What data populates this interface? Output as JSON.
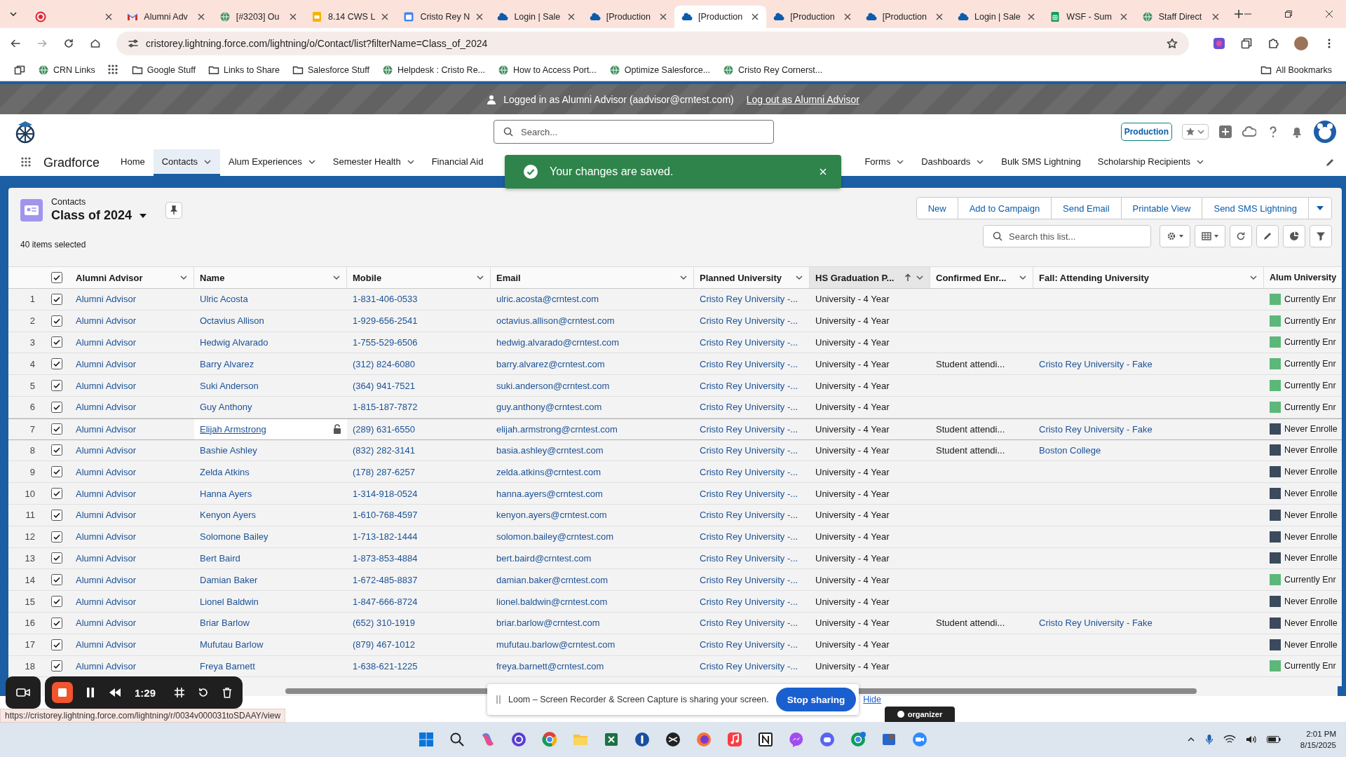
{
  "browser": {
    "tabs": [
      {
        "kind": "record",
        "selected": false
      },
      {
        "title": "Alumni Adv",
        "kind": "mail",
        "selected": false
      },
      {
        "title": "[#3203] Ou",
        "kind": "globe",
        "selected": false
      },
      {
        "title": "8.14 CWS L",
        "kind": "slides",
        "selected": false
      },
      {
        "title": "Cristo Rey N",
        "kind": "calendar",
        "selected": false
      },
      {
        "title": "Login | Sale",
        "kind": "cloud",
        "selected": false
      },
      {
        "title": "[Production",
        "kind": "cloud",
        "selected": false
      },
      {
        "title": "[Production",
        "kind": "cloud",
        "selected": true
      },
      {
        "title": "[Production",
        "kind": "cloud",
        "selected": false
      },
      {
        "title": "[Production",
        "kind": "cloud",
        "selected": false
      },
      {
        "title": "Login | Sale",
        "kind": "cloud",
        "selected": false
      },
      {
        "title": "WSF - Sum",
        "kind": "sheets",
        "selected": false
      },
      {
        "title": "Staff Direct",
        "kind": "globe",
        "selected": false
      }
    ],
    "address": "cristorey.lightning.force.com/lightning/o/Contact/list?filterName=Class_of_2024",
    "bookmarks": [
      {
        "label": "CRN Links",
        "kind": "site"
      },
      {
        "kind": "apps"
      },
      {
        "label": "Google Stuff",
        "kind": "folder"
      },
      {
        "label": "Links to Share",
        "kind": "folder"
      },
      {
        "label": "Salesforce Stuff",
        "kind": "folder"
      },
      {
        "label": "Helpdesk : Cristo Re...",
        "kind": "site"
      },
      {
        "label": "How to Access Port...",
        "kind": "site"
      },
      {
        "label": "Optimize Salesforce...",
        "kind": "site"
      },
      {
        "label": "Cristo Rey Cornerst...",
        "kind": "site"
      }
    ],
    "all_bookmarks": "All Bookmarks"
  },
  "banner": {
    "text": "Logged in as Alumni Advisor (aadvisor@crntest.com)",
    "link": "Log out as Alumni Advisor"
  },
  "header": {
    "search_placeholder": "Search...",
    "org_badge": "Production"
  },
  "nav": {
    "app": "Gradforce",
    "items": [
      {
        "label": "Home",
        "selected": false,
        "menu": false
      },
      {
        "label": "Contacts",
        "selected": true,
        "menu": true
      },
      {
        "label": "Alum Experiences",
        "selected": false,
        "menu": true
      },
      {
        "label": "Semester Health",
        "selected": false,
        "menu": true
      },
      {
        "label": "Financial Aid",
        "selected": false,
        "menu": false
      },
      {
        "label": "Forms",
        "selected": false,
        "menu": true
      },
      {
        "label": "Dashboards",
        "selected": false,
        "menu": true
      },
      {
        "label": "Bulk SMS Lightning",
        "selected": false,
        "menu": false
      },
      {
        "label": "Scholarship Recipients",
        "selected": false,
        "menu": true
      }
    ]
  },
  "toast": {
    "message": "Your changes are saved."
  },
  "list": {
    "object": "Contacts",
    "title": "Class of 2024",
    "selected_count": "40 items selected",
    "actions": [
      "New",
      "Add to Campaign",
      "Send Email",
      "Printable View",
      "Send SMS Lightning"
    ],
    "search_placeholder": "Search this list..."
  },
  "table": {
    "all_checked": true,
    "columns": [
      {
        "label": "Alumni Advisor",
        "sorted": false
      },
      {
        "label": "Name",
        "sorted": false
      },
      {
        "label": "Mobile",
        "sorted": false
      },
      {
        "label": "Email",
        "sorted": false
      },
      {
        "label": "Planned University",
        "sorted": false
      },
      {
        "label": "HS Graduation P...",
        "sorted": true
      },
      {
        "label": "Confirmed Enr...",
        "sorted": false
      },
      {
        "label": "Fall: Attending University",
        "sorted": false
      },
      {
        "label": "Alum University",
        "sorted": false
      }
    ],
    "rows": [
      {
        "n": "1",
        "checked": true,
        "hovered": false,
        "advisor": "Alumni Advisor",
        "name": "Ulric Acosta",
        "mobile": "1-831-406-0533",
        "email": "ulric.acosta@crntest.com",
        "planned": "Cristo Rey University -...",
        "hs": "University - 4 Year",
        "alum": "Currently Enr",
        "color": "#5cb878"
      },
      {
        "n": "2",
        "checked": true,
        "hovered": false,
        "advisor": "Alumni Advisor",
        "name": "Octavius Allison",
        "mobile": "1-929-656-2541",
        "email": "octavius.allison@crntest.com",
        "planned": "Cristo Rey University -...",
        "hs": "University - 4 Year",
        "alum": "Currently Enr",
        "color": "#5cb878"
      },
      {
        "n": "3",
        "checked": true,
        "hovered": false,
        "advisor": "Alumni Advisor",
        "name": "Hedwig Alvarado",
        "mobile": "1-755-529-6506",
        "email": "hedwig.alvarado@crntest.com",
        "planned": "Cristo Rey University -...",
        "hs": "University - 4 Year",
        "alum": "Currently Enr",
        "color": "#5cb878"
      },
      {
        "n": "4",
        "checked": true,
        "hovered": false,
        "advisor": "Alumni Advisor",
        "name": "Barry Alvarez",
        "mobile": "(312) 824-6080",
        "email": "barry.alvarez@crntest.com",
        "planned": "Cristo Rey University -...",
        "hs": "University - 4 Year",
        "confirmed": "Student attendi...",
        "fall": "Cristo Rey University - Fake",
        "alum": "Currently Enr",
        "color": "#5cb878"
      },
      {
        "n": "5",
        "checked": true,
        "hovered": false,
        "advisor": "Alumni Advisor",
        "name": "Suki Anderson",
        "mobile": "(364) 941-7521",
        "email": "suki.anderson@crntest.com",
        "planned": "Cristo Rey University -...",
        "hs": "University - 4 Year",
        "alum": "Currently Enr",
        "color": "#5cb878"
      },
      {
        "n": "6",
        "checked": true,
        "hovered": false,
        "advisor": "Alumni Advisor",
        "name": "Guy Anthony",
        "mobile": "1-815-187-7872",
        "email": "guy.anthony@crntest.com",
        "planned": "Cristo Rey University -...",
        "hs": "University - 4 Year",
        "alum": "Currently Enr",
        "color": "#5cb878"
      },
      {
        "n": "7",
        "checked": true,
        "hovered": true,
        "advisor": "Alumni Advisor",
        "name": "Elijah Armstrong",
        "mobile": "(289) 631-6550",
        "email": "elijah.armstrong@crntest.com",
        "planned": "Cristo Rey University -...",
        "hs": "University - 4 Year",
        "confirmed": "Student attendi...",
        "fall": "Cristo Rey University - Fake",
        "alum": "Never Enrolle",
        "color": "#3b4a5c"
      },
      {
        "n": "8",
        "checked": true,
        "hovered": false,
        "advisor": "Alumni Advisor",
        "name": "Bashie Ashley",
        "mobile": "(832) 282-3141",
        "email": "basia.ashley@crntest.com",
        "planned": "Cristo Rey University -...",
        "hs": "University - 4 Year",
        "confirmed": "Student attendi...",
        "fall": "Boston College",
        "alum": "Never Enrolle",
        "color": "#3b4a5c"
      },
      {
        "n": "9",
        "checked": true,
        "hovered": false,
        "advisor": "Alumni Advisor",
        "name": "Zelda Atkins",
        "mobile": "(178) 287-6257",
        "email": "zelda.atkins@crntest.com",
        "planned": "Cristo Rey University -...",
        "hs": "University - 4 Year",
        "alum": "Never Enrolle",
        "color": "#3b4a5c"
      },
      {
        "n": "10",
        "checked": true,
        "hovered": false,
        "advisor": "Alumni Advisor",
        "name": "Hanna Ayers",
        "mobile": "1-314-918-0524",
        "email": "hanna.ayers@crntest.com",
        "planned": "Cristo Rey University -...",
        "hs": "University - 4 Year",
        "alum": "Never Enrolle",
        "color": "#3b4a5c"
      },
      {
        "n": "11",
        "checked": true,
        "hovered": false,
        "advisor": "Alumni Advisor",
        "name": "Kenyon Ayers",
        "mobile": "1-610-768-4597",
        "email": "kenyon.ayers@crntest.com",
        "planned": "Cristo Rey University -...",
        "hs": "University - 4 Year",
        "alum": "Never Enrolle",
        "color": "#3b4a5c"
      },
      {
        "n": "12",
        "checked": true,
        "hovered": false,
        "advisor": "Alumni Advisor",
        "name": "Solomone Bailey",
        "mobile": "1-713-182-1444",
        "email": "solomon.bailey@crntest.com",
        "planned": "Cristo Rey University -...",
        "hs": "University - 4 Year",
        "alum": "Never Enrolle",
        "color": "#3b4a5c"
      },
      {
        "n": "13",
        "checked": true,
        "hovered": false,
        "advisor": "Alumni Advisor",
        "name": "Bert Baird",
        "mobile": "1-873-853-4884",
        "email": "bert.baird@crntest.com",
        "planned": "Cristo Rey University -...",
        "hs": "University - 4 Year",
        "alum": "Never Enrolle",
        "color": "#3b4a5c"
      },
      {
        "n": "14",
        "checked": true,
        "hovered": false,
        "advisor": "Alumni Advisor",
        "name": "Damian Baker",
        "mobile": "1-672-485-8837",
        "email": "damian.baker@crntest.com",
        "planned": "Cristo Rey University -...",
        "hs": "University - 4 Year",
        "alum": "Currently Enr",
        "color": "#5cb878"
      },
      {
        "n": "15",
        "checked": true,
        "hovered": false,
        "advisor": "Alumni Advisor",
        "name": "Lionel Baldwin",
        "mobile": "1-847-666-8724",
        "email": "lionel.baldwin@crntest.com",
        "planned": "Cristo Rey University -...",
        "hs": "University - 4 Year",
        "alum": "Never Enrolle",
        "color": "#3b4a5c"
      },
      {
        "n": "16",
        "checked": true,
        "hovered": false,
        "advisor": "Alumni Advisor",
        "name": "Briar Barlow",
        "mobile": "(652) 310-1919",
        "email": "briar.barlow@crntest.com",
        "planned": "Cristo Rey University -...",
        "hs": "University - 4 Year",
        "confirmed": "Student attendi...",
        "fall": "Cristo Rey University - Fake",
        "alum": "Never Enrolle",
        "color": "#3b4a5c"
      },
      {
        "n": "17",
        "checked": true,
        "hovered": false,
        "advisor": "Alumni Advisor",
        "name": "Mufutau Barlow",
        "mobile": "(879) 467-1012",
        "email": "mufutau.barlow@crntest.com",
        "planned": "Cristo Rey University -...",
        "hs": "University - 4 Year",
        "alum": "Never Enrolle",
        "color": "#3b4a5c"
      },
      {
        "n": "18",
        "checked": true,
        "hovered": false,
        "advisor": "Alumni Advisor",
        "name": "Freya Barnett",
        "mobile": "1-638-621-1225",
        "email": "freya.barnett@crntest.com",
        "planned": "Cristo Rey University -...",
        "hs": "University - 4 Year",
        "alum": "Currently Enr",
        "color": "#5cb878"
      }
    ]
  },
  "loom": {
    "timer": "1:29",
    "message": "Loom – Screen Recorder & Screen Capture is sharing your screen.",
    "stop": "Stop sharing",
    "hide": "Hide"
  },
  "status_url": "https://cristorey.lightning.force.com/lightning/r/0034v000031toSDAAY/view",
  "organizer": "organizer",
  "taskbar": {
    "time": "2:01 PM",
    "date": "8/15/2025"
  }
}
